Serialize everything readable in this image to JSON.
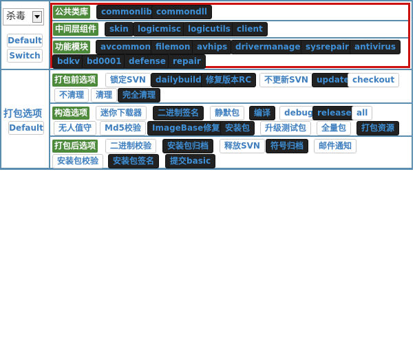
{
  "sidebar": {
    "select_value": "杀毒",
    "default_label": "Default",
    "switch_label": "Switch",
    "pack_label": "打包选项",
    "pack_default_label": "Default"
  },
  "groups": {
    "common": {
      "title": "公共类库",
      "items": [
        "commonlib",
        "commondll"
      ]
    },
    "middle": {
      "title": "中间层组件",
      "items": [
        "skin",
        "logicmisc",
        "logicutils",
        "client"
      ]
    },
    "feature": {
      "title": "功能模块",
      "items": [
        "avcommon",
        "filemon",
        "avhips",
        "drivermanager",
        "sysrepair",
        "antivirus",
        "bdkv",
        "bd0001",
        "defense",
        "repair"
      ]
    },
    "prepack": {
      "title": "打包前选项",
      "items": [
        "锁定SVN",
        "dailybuild",
        "修复版本RC",
        "不更新SVN",
        "update",
        "checkout",
        "不清理",
        "清理",
        "完全清理"
      ]
    },
    "build": {
      "title": "构造选项",
      "items": [
        "迷你下载器",
        "二进制签名",
        "静默包",
        "编译",
        "debug",
        "release",
        "all",
        "无人值守",
        "Md5校验",
        "ImageBase修复",
        "安装包",
        "升级测试包",
        "全量包",
        "打包资源"
      ]
    },
    "postpack": {
      "title": "打包后选项",
      "items": [
        "二进制校验",
        "安装包归档",
        "释放SVN",
        "符号归档",
        "邮件通知",
        "安装包校验",
        "安装包签名",
        "提交basic"
      ]
    }
  }
}
